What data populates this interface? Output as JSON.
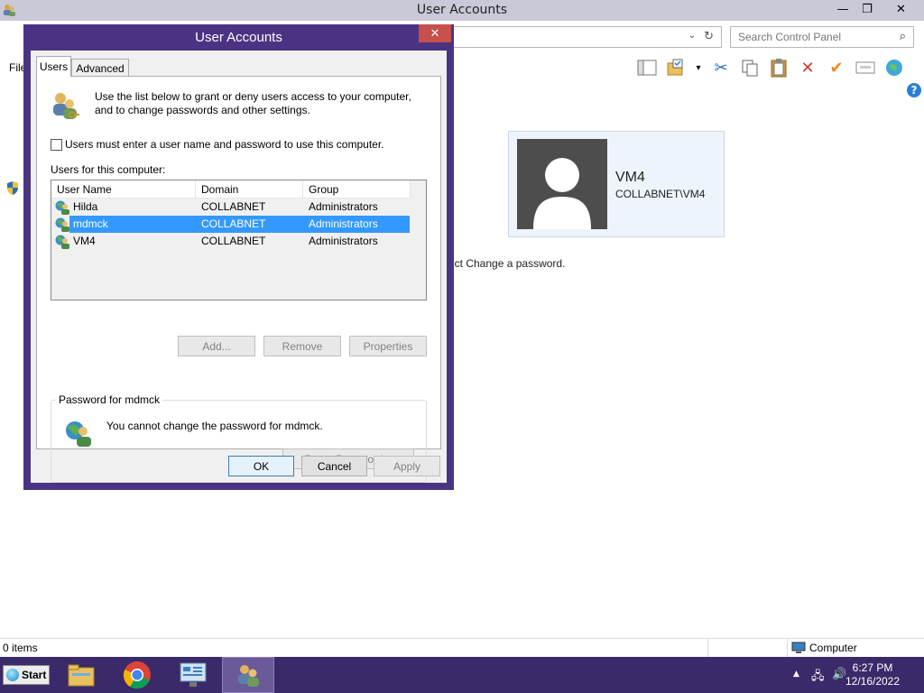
{
  "main_window": {
    "title": "User Accounts",
    "menu_file": "File",
    "search_placeholder": "Search Control Panel",
    "user_tile": {
      "name": "VM4",
      "domain": "COLLABNET\\VM4"
    },
    "hint_text": "ect Change a password.",
    "status_items": "0 items",
    "status_computer": "Computer"
  },
  "dialog": {
    "title": "User Accounts",
    "tabs": [
      {
        "label": "Users"
      },
      {
        "label": "Advanced"
      }
    ],
    "intro": "Use the list below to grant or deny users access to your computer, and to change passwords and other settings.",
    "must_login_label": "Users must enter a user name and password to use this computer.",
    "must_login_checked": false,
    "users_caption": "Users for this computer:",
    "columns": [
      "User Name",
      "Domain",
      "Group"
    ],
    "users": [
      {
        "name": "Hilda",
        "domain": "COLLABNET",
        "group": "Administrators"
      },
      {
        "name": "mdmck",
        "domain": "COLLABNET",
        "group": "Administrators"
      },
      {
        "name": "VM4",
        "domain": "COLLABNET",
        "group": "Administrators"
      }
    ],
    "selected_user": "mdmck",
    "buttons": {
      "add": "Add...",
      "remove": "Remove",
      "properties": "Properties"
    },
    "password_group": {
      "legend": "Password for mdmck",
      "message": "You cannot change the password for mdmck.",
      "reset_button": "Reset Password..."
    },
    "footer": {
      "ok": "OK",
      "cancel": "Cancel",
      "apply": "Apply"
    }
  },
  "taskbar": {
    "start_label": "Start",
    "clock_time": "6:27 PM",
    "clock_date": "12/16/2022"
  },
  "colors": {
    "dialog_frame": "#4b3384",
    "taskbar": "#3a2a6a",
    "selection": "#3399ff",
    "close_button": "#c7504b"
  }
}
